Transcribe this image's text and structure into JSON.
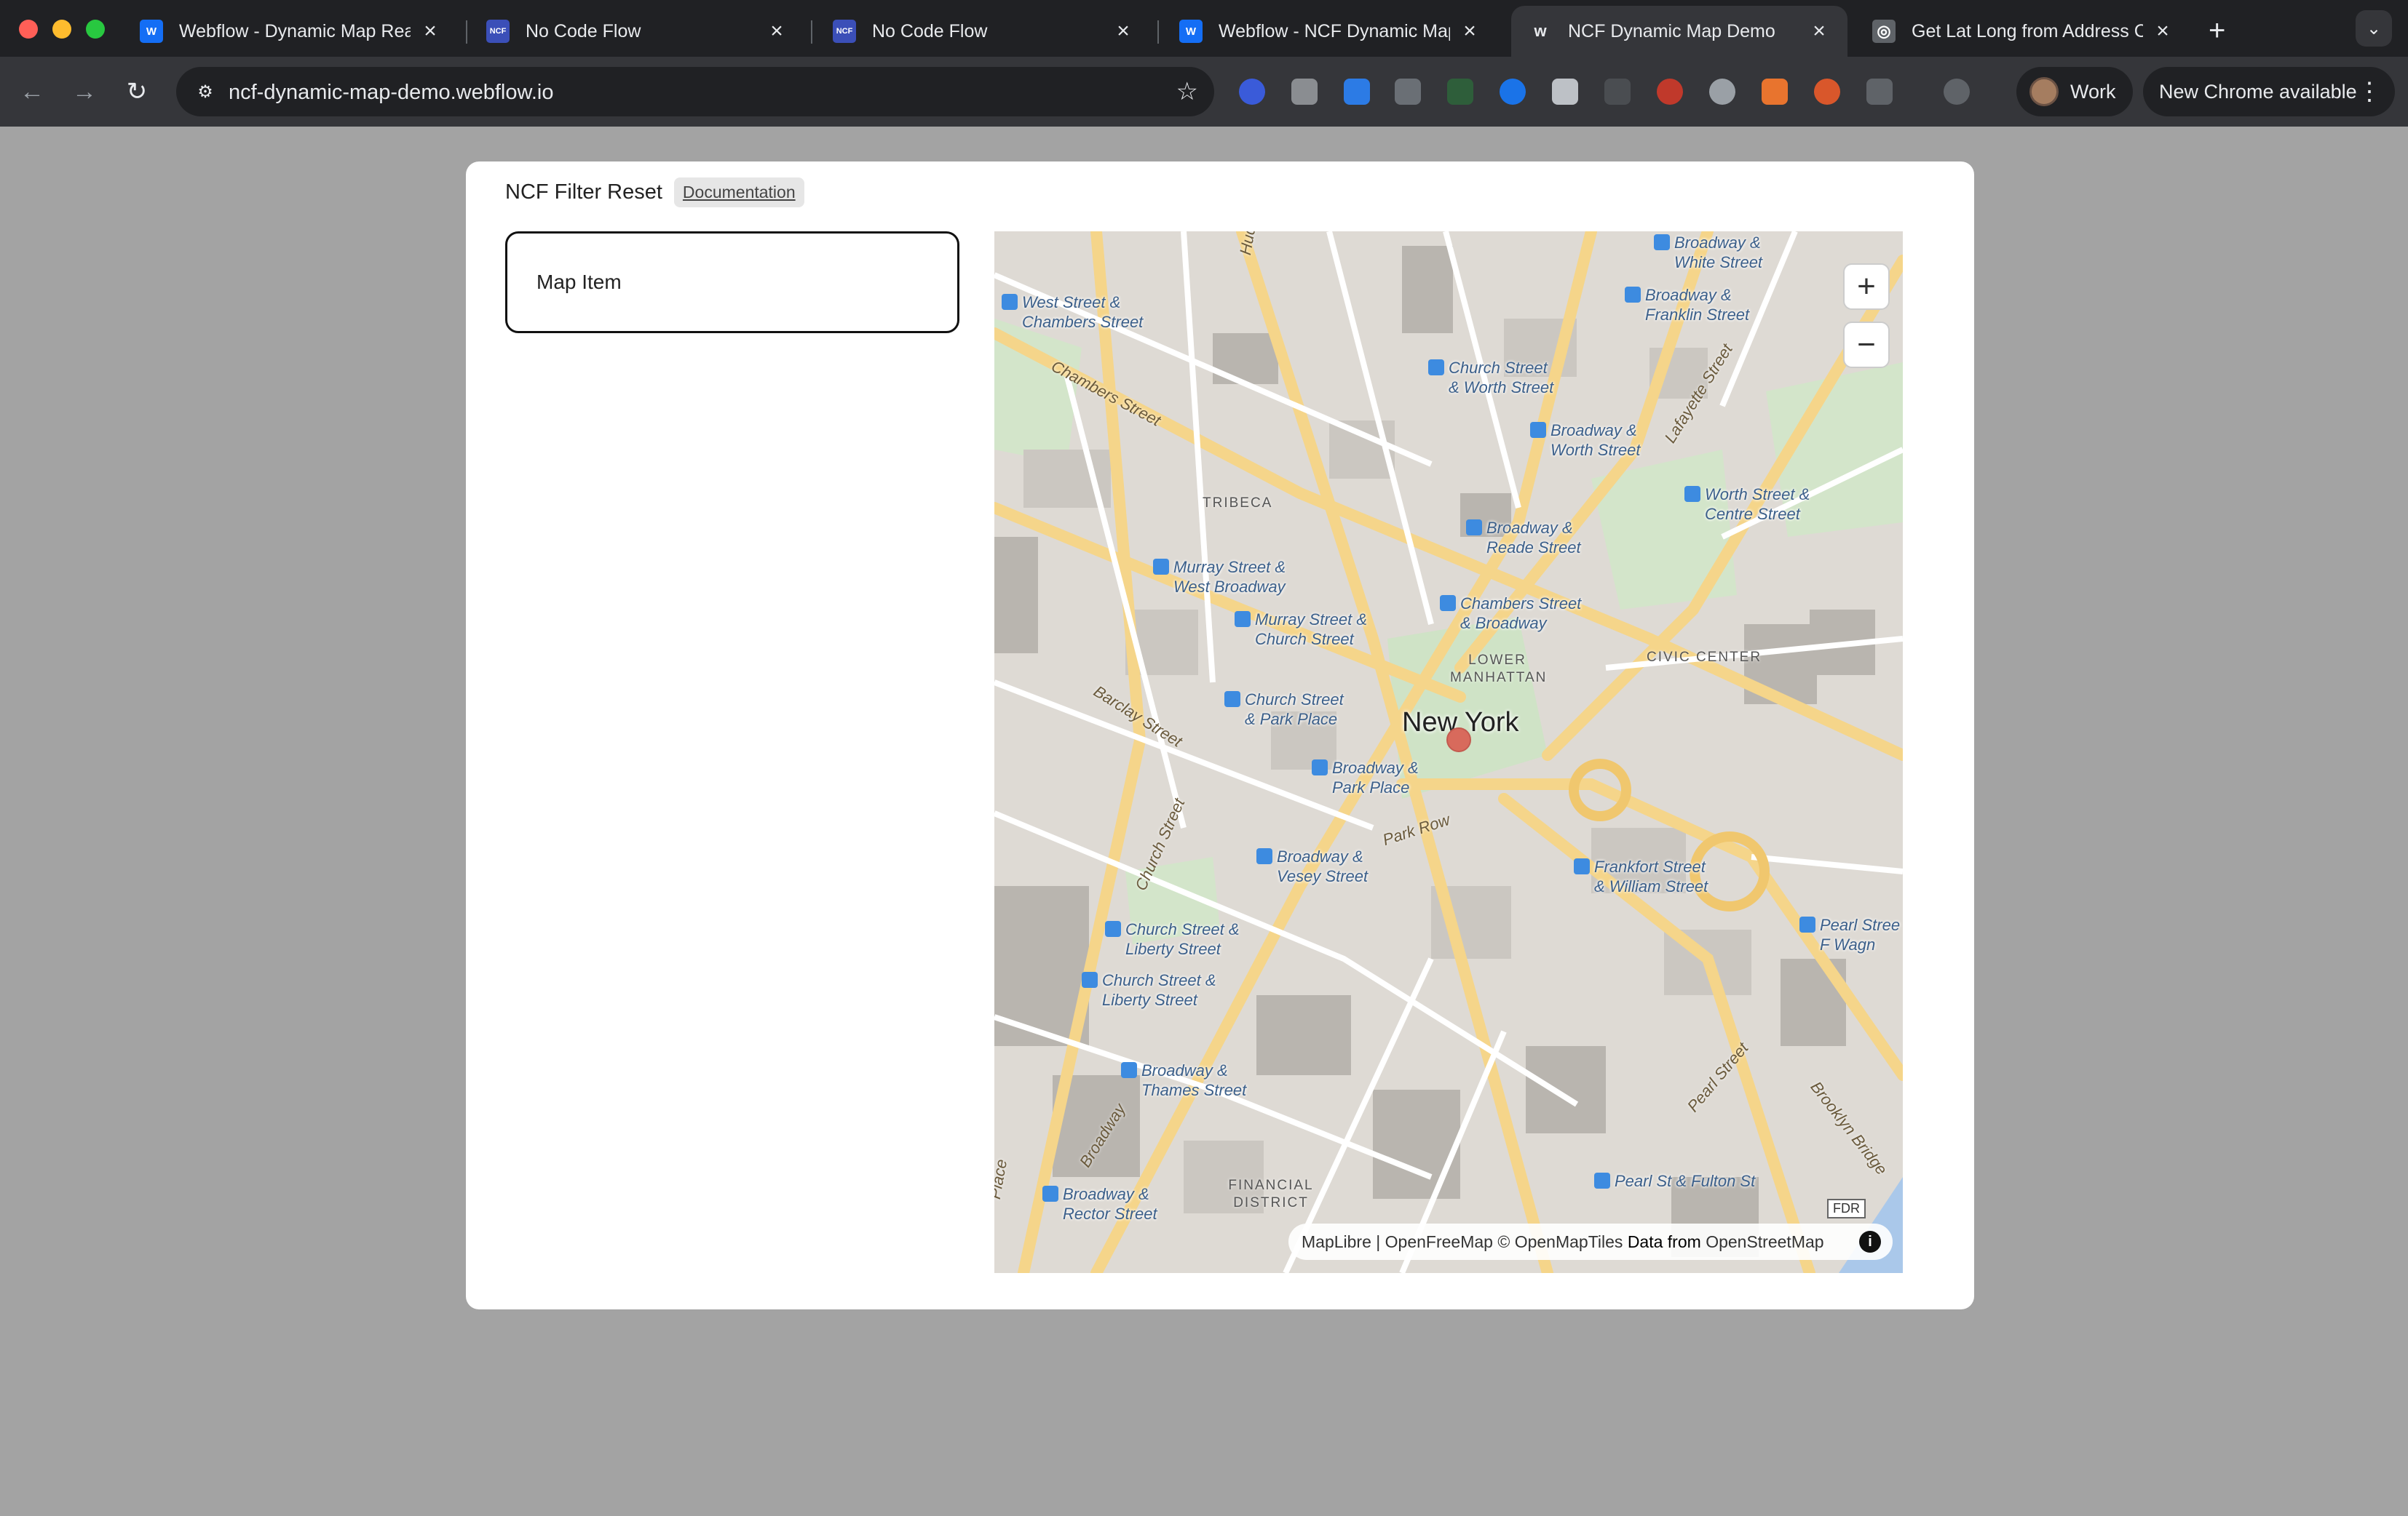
{
  "browser": {
    "tabs": [
      {
        "title": "Webflow - Dynamic Map Real",
        "favicon_color": "#146ef5",
        "favicon_text": "W"
      },
      {
        "title": "No Code Flow",
        "favicon_color": "#3b4fb8",
        "favicon_text": "NCF"
      },
      {
        "title": "No Code Flow",
        "favicon_color": "#3b4fb8",
        "favicon_text": "NCF"
      },
      {
        "title": "Webflow - NCF Dynamic Map",
        "favicon_color": "#146ef5",
        "favicon_text": "W"
      },
      {
        "title": "NCF Dynamic Map Demo",
        "favicon_color": "#35363a",
        "favicon_text": "w"
      },
      {
        "title": "Get Lat Long from Address C",
        "favicon_color": "#5f6368",
        "favicon_text": "◎"
      }
    ],
    "active_tab_index": 4,
    "url": "ncf-dynamic-map-demo.webflow.io",
    "profile_label": "Work",
    "update_label": "New Chrome available"
  },
  "page": {
    "brand": "NCF Filter Reset",
    "doc_link": "Documentation",
    "map_item_label": "Map Item"
  },
  "map": {
    "city_label": "New York",
    "zoom_in": "+",
    "zoom_out": "−",
    "attribution": {
      "maplibre": "MapLibre",
      "sep": "|",
      "openfreemap": "OpenFreeMap",
      "openmaptiles": "© OpenMapTiles",
      "data_from": "Data from",
      "osm": "OpenStreetMap"
    },
    "info_glyph": "i",
    "fdr_label": "FDR",
    "transit_stops": [
      {
        "line1": "Broadway &",
        "line2": "White Street"
      },
      {
        "line1": "Broadway &",
        "line2": "Franklin Street"
      },
      {
        "line1": "West Street &",
        "line2": "Chambers Street"
      },
      {
        "line1": "Church Street",
        "line2": "& Worth Street"
      },
      {
        "line1": "Broadway &",
        "line2": "Worth Street"
      },
      {
        "line1": "Worth Street &",
        "line2": "Centre Street"
      },
      {
        "line1": "Broadway &",
        "line2": "Reade Street"
      },
      {
        "line1": "Murray Street &",
        "line2": "West Broadway"
      },
      {
        "line1": "Chambers Street",
        "line2": "& Broadway"
      },
      {
        "line1": "Murray Street &",
        "line2": "Church Street"
      },
      {
        "line1": "Church Street",
        "line2": "& Park Place"
      },
      {
        "line1": "Broadway &",
        "line2": "Park Place"
      },
      {
        "line1": "Broadway &",
        "line2": "Vesey Street"
      },
      {
        "line1": "Frankfort Street",
        "line2": "& William Street"
      },
      {
        "line1": "Church Street &",
        "line2": "Liberty Street"
      },
      {
        "line1": "Church Street &",
        "line2": "Liberty Street"
      },
      {
        "line1": "Pearl Stree",
        "line2": "F Wagn"
      },
      {
        "line1": "Broadway &",
        "line2": "Thames Street"
      },
      {
        "line1": "Broadway &",
        "line2": "Rector Street"
      },
      {
        "line1": "Pearl St & Fulton St",
        "line2": ""
      }
    ],
    "streets": [
      "Hudson",
      "Chambers Street",
      "Lafayette Street",
      "Barclay Street",
      "Park Row",
      "Church Street",
      "Pearl Street",
      "Brooklyn Bridge",
      "Broadway",
      "Place"
    ],
    "areas": [
      "TRIBECA",
      "LOWER MANHATTAN",
      "CIVIC CENTER",
      "FINANCIAL DISTRICT"
    ]
  }
}
